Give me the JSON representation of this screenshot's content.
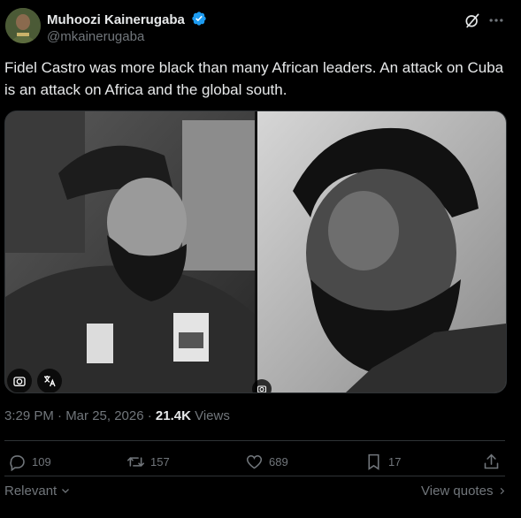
{
  "author": {
    "name": "Muhoozi Kainerugaba",
    "handle": "@mkainerugaba"
  },
  "tweet": {
    "text": "Fidel Castro was more black than many African leaders. An attack on Cuba is an attack on Africa and the global south."
  },
  "meta": {
    "time": "3:29 PM · Mar 25, 2026 · ",
    "views_count": "21.4K",
    "views_label": " Views"
  },
  "actions": {
    "replies": "109",
    "reposts": "157",
    "likes": "689",
    "bookmarks": "17"
  },
  "footer": {
    "sort_label": "Relevant",
    "view_quotes": "View quotes"
  },
  "colors": {
    "background": "#000000",
    "text": "#e7e9ea",
    "muted": "#71767b",
    "verified": "#1d9bf0",
    "divider": "#2f3336"
  }
}
